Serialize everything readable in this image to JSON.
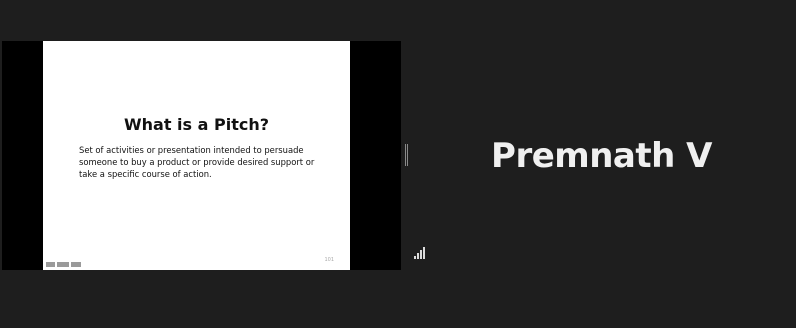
{
  "screen_share": {
    "slide": {
      "title": "What is a Pitch?",
      "body_lines": [
        "Set of activities or presentation intended to persuade",
        "someone to buy a product or provide desired support or",
        "take a specific course of action."
      ],
      "logo_icon": "institution-logo-icon",
      "page_number": "101"
    }
  },
  "participant": {
    "name": "Premnath V",
    "signal_icon": "signal-strength-icon"
  },
  "colors": {
    "background": "#1e1e1e",
    "share_letterbox": "#000000",
    "slide_background": "#ffffff",
    "name_text": "#f0f0f0"
  }
}
